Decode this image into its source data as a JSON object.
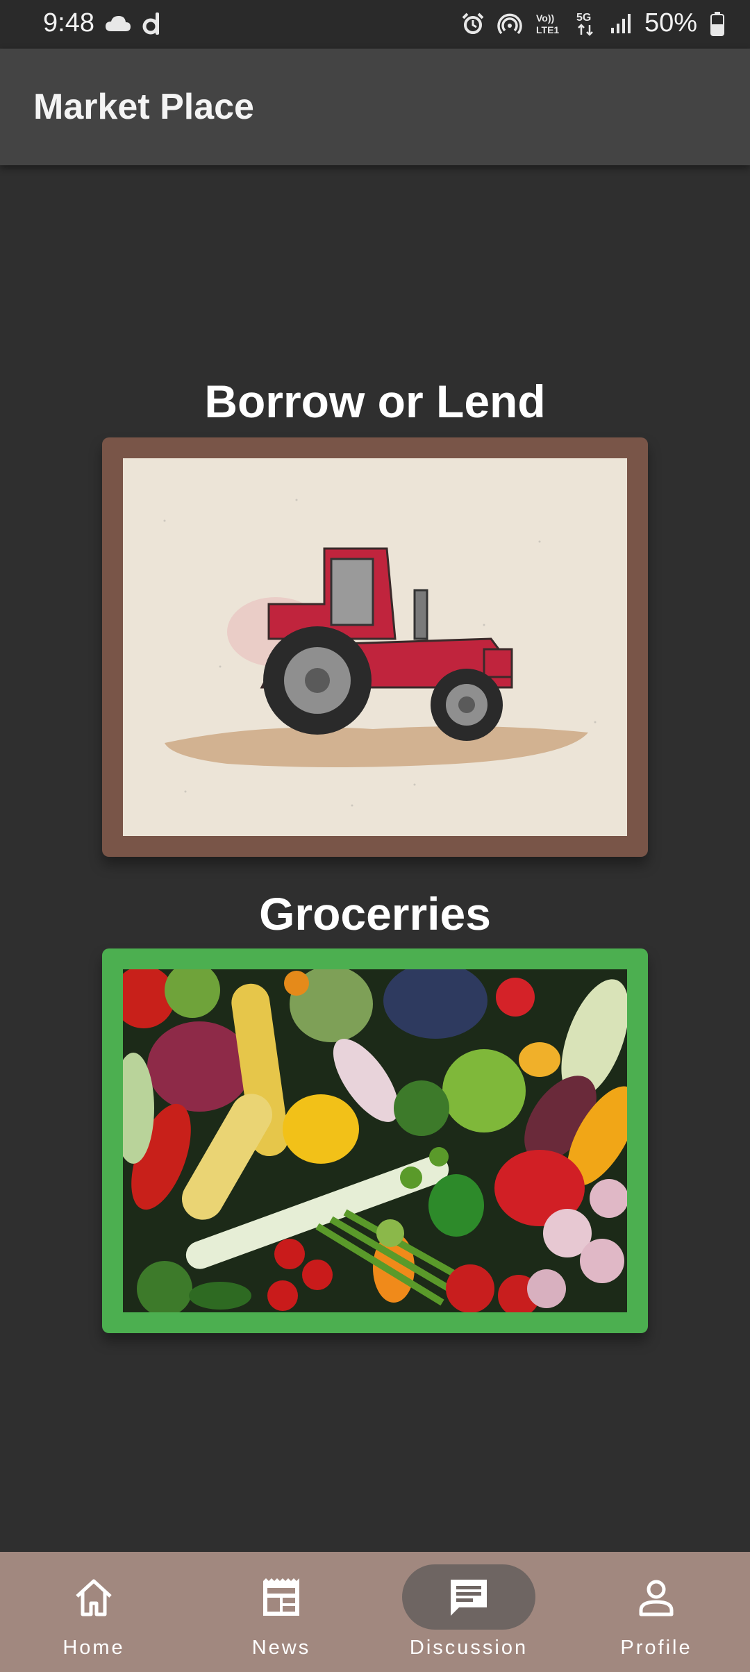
{
  "status_bar": {
    "time": "9:48",
    "battery": "50%",
    "left_icons": [
      "cloud-icon",
      "d-app-icon"
    ],
    "right_icons": [
      "alarm-icon",
      "hotspot-icon",
      "volte-icon",
      "5g-icon",
      "signal-icon",
      "battery-icon"
    ]
  },
  "app_bar": {
    "title": "Market Place"
  },
  "sections": [
    {
      "title": "Borrow or Lend",
      "frame_color": "#795548",
      "image": "tractor-illustration"
    },
    {
      "title": "Grocerries",
      "frame_color": "#4caf50",
      "image": "vegetables-photo"
    }
  ],
  "bottom_nav": {
    "items": [
      {
        "label": "Home",
        "icon": "home-icon",
        "active": false
      },
      {
        "label": "News",
        "icon": "news-icon",
        "active": false
      },
      {
        "label": "Discussion",
        "icon": "discussion-icon",
        "active": true
      },
      {
        "label": "Profile",
        "icon": "profile-icon",
        "active": false
      }
    ]
  },
  "colors": {
    "background": "#2f2f2f",
    "app_bar": "#444444",
    "bottom_nav": "#a1887f",
    "active_pill": "#6e6562"
  }
}
